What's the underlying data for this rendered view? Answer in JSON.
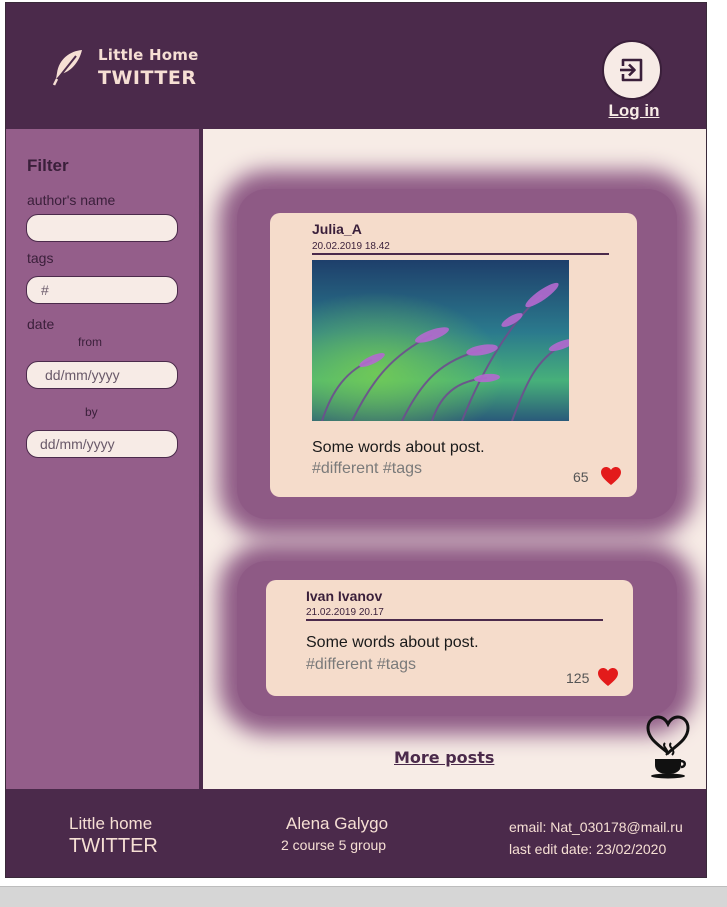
{
  "header": {
    "logo_small": "Little Home",
    "logo_big": "TWITTER",
    "login_label": "Log in"
  },
  "filter": {
    "title": "Filter",
    "author_label": "author's name",
    "author_value": "",
    "tags_label": "tags",
    "tags_placeholder": "#",
    "date_label": "date",
    "from_label": "from",
    "from_placeholder": "dd/mm/yyyy",
    "by_label": "by",
    "by_placeholder": "dd/mm/yyyy"
  },
  "posts": [
    {
      "author": "Julia_A",
      "date": "20.02.2019 18.42",
      "has_image": true,
      "text": "Some words about post.",
      "tags": "#different #tags",
      "likes": "65"
    },
    {
      "author": "Ivan Ivanov",
      "date": "21.02.2019 20.17",
      "has_image": false,
      "text": "Some words about post.",
      "tags": "#different #tags",
      "likes": "125"
    }
  ],
  "more_posts": "More posts",
  "footer": {
    "brand_small": "Little home",
    "brand_big": "TWITTER",
    "author_name": "Alena Galygo",
    "author_group": "2 course 5 group",
    "email": "email: Nat_030178@mail.ru",
    "last_edit": "last edit date: 23/02/2020"
  },
  "colors": {
    "header_bg": "#4b2a4b",
    "sidebar_bg": "#945e8a",
    "content_bg": "#f7ece6",
    "card_bg": "#f5dccb",
    "heart": "#e31b1b"
  },
  "icons": {
    "logo": "feather-icon",
    "login": "sign-in-icon",
    "like": "heart-icon",
    "decor": "coffee-cup-icon"
  }
}
